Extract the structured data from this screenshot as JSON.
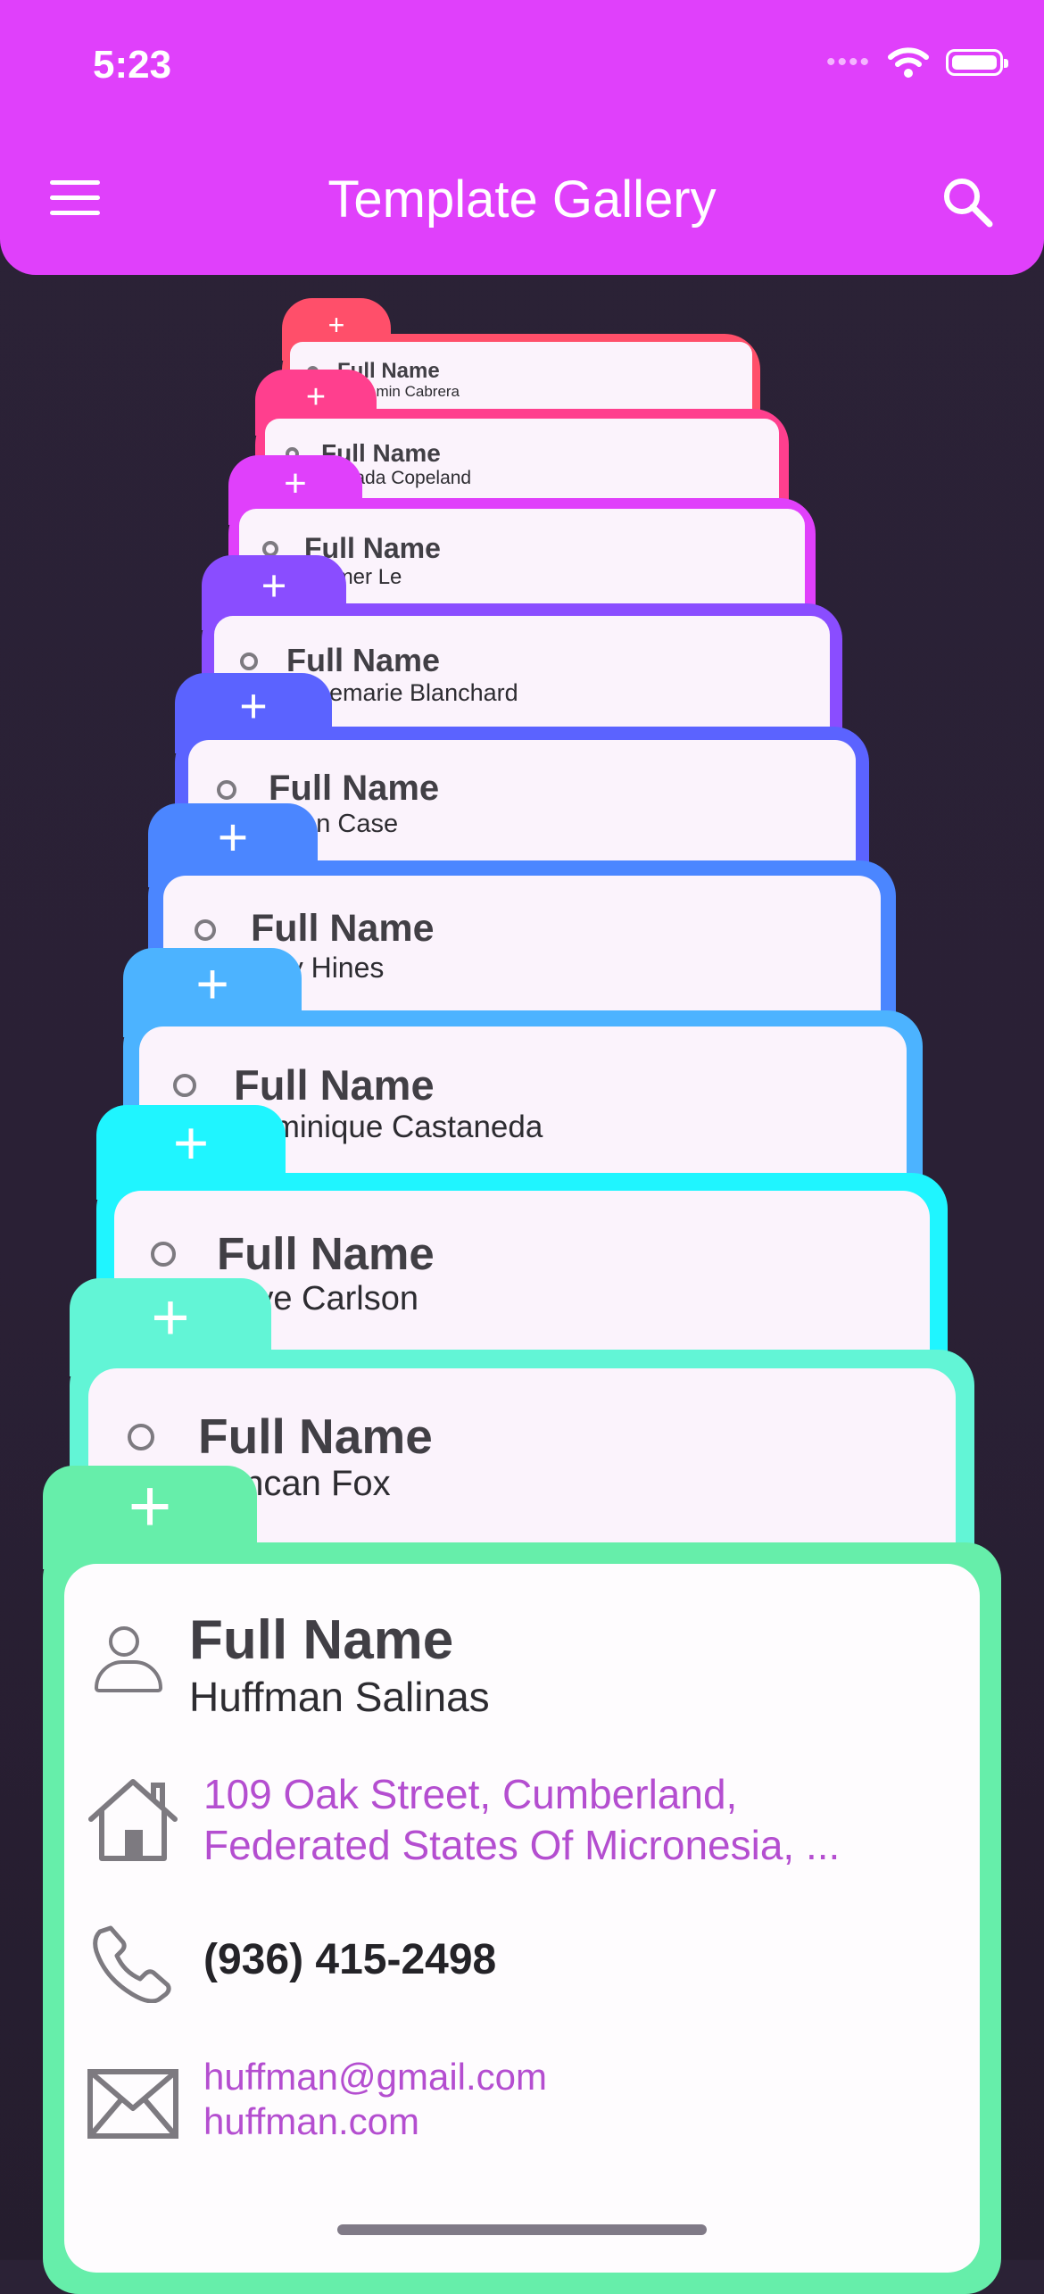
{
  "status": {
    "time": "5:23"
  },
  "appbar": {
    "title": "Template Gallery"
  },
  "cards": [
    {
      "label": "Full Name",
      "name": "Benjamin Cabrera",
      "color": "#ff4f6a",
      "tab_symbol": "+"
    },
    {
      "label": "Full Name",
      "name": "Estrada Copeland",
      "color": "#ff3f8e",
      "tab_symbol": "+"
    },
    {
      "label": "Full Name",
      "name": "Palmer Le",
      "color": "#e040fb",
      "tab_symbol": "+"
    },
    {
      "label": "Full Name",
      "name": "Rosemarie Blanchard",
      "color": "#8a4dff",
      "tab_symbol": "+"
    },
    {
      "label": "Full Name",
      "name": "Dean Case",
      "color": "#5b63ff",
      "tab_symbol": "+"
    },
    {
      "label": "Full Name",
      "name": "Guy Hines",
      "color": "#4b86ff",
      "tab_symbol": "+"
    },
    {
      "label": "Full Name",
      "name": "Dominique Castaneda",
      "color": "#4cb3ff",
      "tab_symbol": "+"
    },
    {
      "label": "Full Name",
      "name": "Faye Carlson",
      "color": "#1ff5ff",
      "tab_symbol": "+"
    },
    {
      "label": "Full Name",
      "name": "Duncan Fox",
      "color": "#62f5d6",
      "tab_symbol": "+"
    },
    {
      "label": "Full Name",
      "name": "Huffman Salinas",
      "color": "#66eeaa",
      "tab_symbol": "+"
    }
  ],
  "front_card": {
    "address_line1": "109 Oak Street, Cumberland,",
    "address_line2": "Federated States Of Micronesia, ...",
    "phone": "(936) 415-2498",
    "email": "huffman@gmail.com",
    "website": "huffman.com"
  },
  "icons": {
    "menu": "menu-icon",
    "search": "search-icon",
    "person": "person-icon",
    "home": "home-icon",
    "phone": "phone-icon",
    "mail": "mail-icon",
    "wifi": "wifi-icon",
    "battery": "battery-icon"
  }
}
